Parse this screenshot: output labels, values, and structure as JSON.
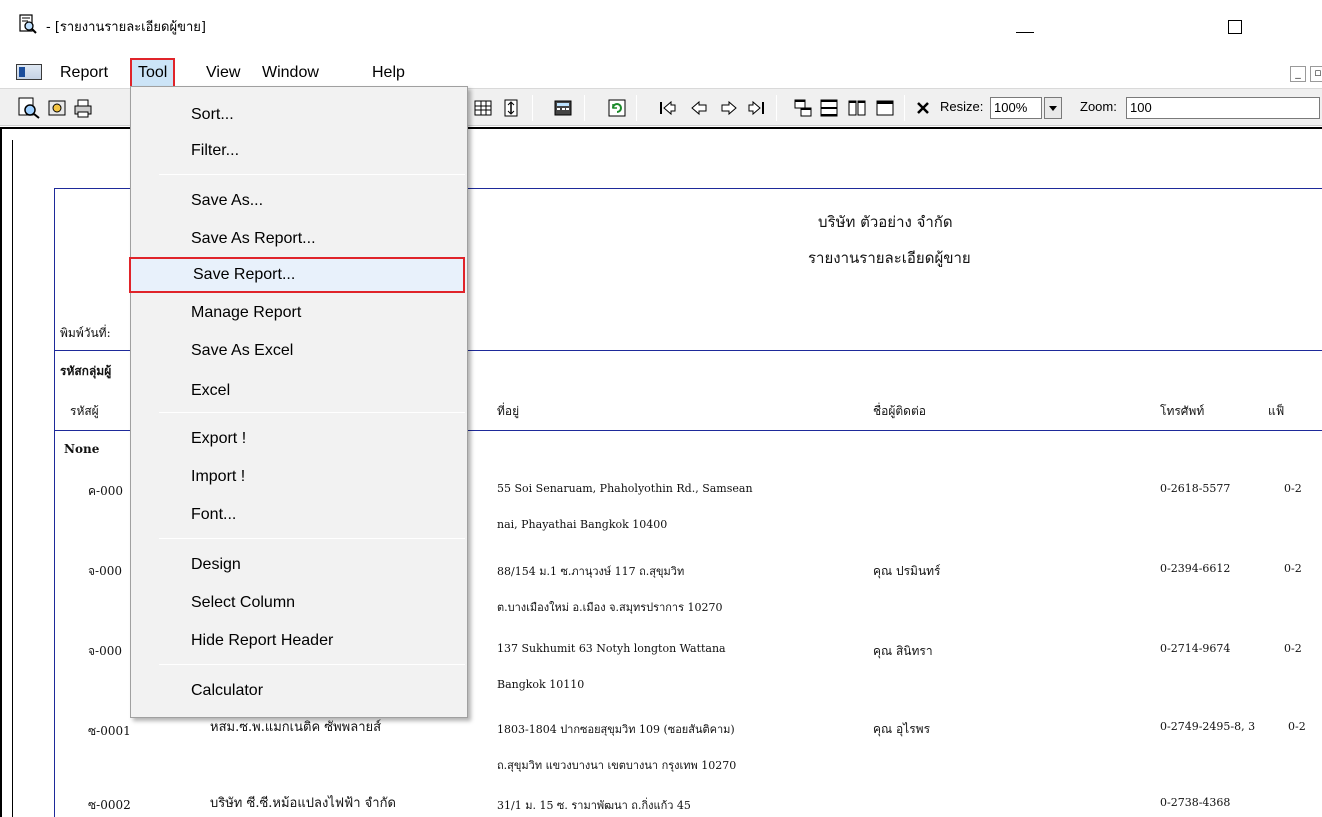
{
  "window": {
    "title": "- [รายงานรายละเอียดผู้ขาย]"
  },
  "menubar": {
    "items": [
      "Report",
      "Tool",
      "View",
      "Window",
      "Help"
    ]
  },
  "toolbar": {
    "resize_label": "Resize:",
    "resize_value": "100%",
    "zoom_label": "Zoom:",
    "zoom_value": "100"
  },
  "tool_menu": {
    "items": [
      "Sort...",
      "Filter...",
      "Save As...",
      "Save As Report...",
      "Save Report...",
      "Manage Report",
      "Save As Excel",
      "Excel",
      "Export !",
      "Import !",
      "Font...",
      "Design",
      "Select Column",
      "Hide Report Header",
      "Calculator"
    ],
    "highlighted": "Save Report..."
  },
  "report": {
    "company": "บริษัท ตัวอย่าง จำกัด",
    "title": "รายงานรายละเอียดผู้ขาย",
    "print_date_label": "พิมพ์วันที่:",
    "group_header": "รหัสกลุ่มผู้",
    "columns": {
      "code": "รหัสผู้",
      "address": "ที่อยู่",
      "contact": "ชื่อผู้ติดต่อ",
      "phone": "โทรศัพท์",
      "fax": "แฟ็"
    },
    "group_name": "None",
    "rows": [
      {
        "code": "ค-000",
        "name": "",
        "address1": "55 Soi Senaruam, Phaholyothin Rd.,  Samsean",
        "address2": "nai, Phayathai Bangkok 10400",
        "contact": "",
        "phone": "0-2618-5577",
        "fax": "0-2"
      },
      {
        "code": "จ-000",
        "name": "",
        "address1": "88/154 ม.1 ซ.ภานุวงษ์ 117 ถ.สุขุมวิท",
        "address2": "ต.บางเมืองใหม่ อ.เมือง จ.สมุทรปราการ 10270",
        "contact": "คุณ ปรมินทร์",
        "phone": "0-2394-6612",
        "fax": "0-2"
      },
      {
        "code": "จ-000",
        "name": "",
        "address1": "137 Sukhumit 63  Notyh longton Wattana",
        "address2": "Bangkok 10110",
        "contact": "คุณ สินิทรา",
        "phone": "0-2714-9674",
        "fax": "0-2"
      },
      {
        "code": "ซ-0001",
        "name": "หสม.ซ.พ.แมกเนติค ซัพพลายส์",
        "address1": "1803-1804 ปากซอยสุขุมวิท 109 (ซอยสันติคาม)",
        "address2": "ถ.สุขุมวิท แขวงบางนา เขตบางนา กรุงเทพ 10270",
        "contact": "คุณ อุไรพร",
        "phone": "0-2749-2495-8, 3",
        "fax": "0-2"
      },
      {
        "code": "ซ-0002",
        "name": "บริษัท ซี.ซี.หม้อแปลงไฟฟ้า จำกัด",
        "address1": "31/1 ม. 15  ซ. รามาพัฒนา ถ.กิ่งแก้ว 45",
        "address2": "",
        "contact": "",
        "phone": "0-2738-4368",
        "fax": ""
      }
    ]
  }
}
